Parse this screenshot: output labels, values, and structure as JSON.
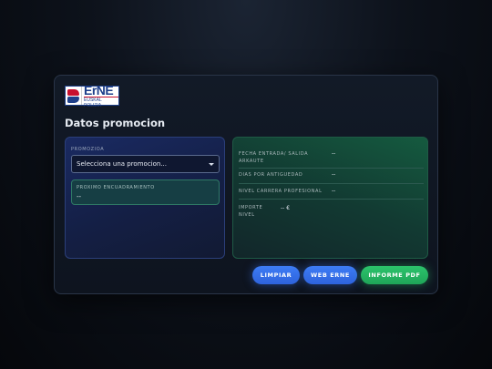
{
  "logo": {
    "text": "ErNE",
    "subtext": "EUSKAL POLIZIA"
  },
  "page": {
    "title": "Datos promocion"
  },
  "left_panel": {
    "promotion_label": "PROMOZIOA",
    "promotion_select_value": "Selecciona una promocion...",
    "next_label": "PROXIMO ENCUADRAMIENTO",
    "next_value": "--"
  },
  "right_panel": {
    "entry_label": "FECHA ENTRADA/ SALIDA ARKAUTE",
    "entry_value": "--",
    "seniority_label": "DIAS POR ANTIGUEDAD",
    "seniority_value": "--",
    "career_label": "NIVEL CARRERA PROFESIONAL",
    "career_value": "--",
    "amount_label": "IMPORTE NIVEL",
    "amount_value": "-- €"
  },
  "actions": {
    "clear_label": "LIMPIAR",
    "web_label": "WEB ERNE",
    "pdf_label": "INFORME PDF"
  },
  "colors": {
    "primary_button": "#2e63dc",
    "success_button": "#1fa558",
    "left_panel_bg": "#1a2a62",
    "right_panel_bg": "#155a3f"
  }
}
